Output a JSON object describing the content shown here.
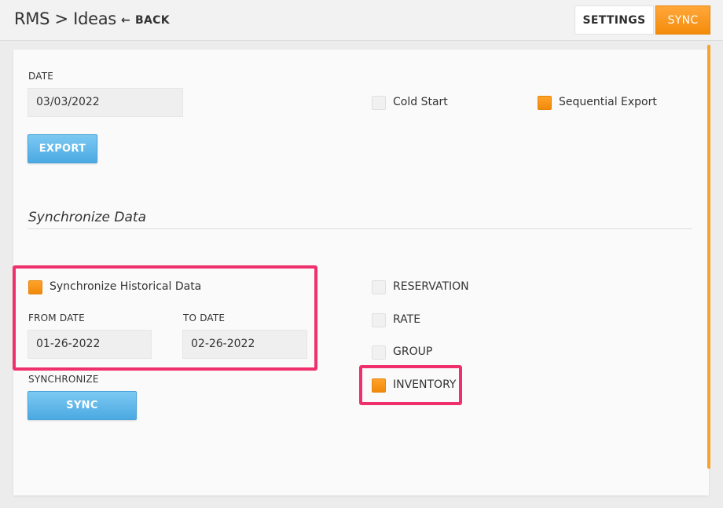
{
  "header": {
    "title": "RMS > Ideas",
    "back_label": "BACK",
    "settings_label": "SETTINGS",
    "sync_label": "SYNC"
  },
  "export": {
    "date_label": "DATE",
    "date_value": "03/03/2022",
    "export_label": "EXPORT",
    "cold_start": {
      "label": "Cold Start",
      "checked": false
    },
    "sequential_export": {
      "label": "Sequential Export",
      "checked": true
    }
  },
  "sync": {
    "section_title": "Synchronize Data",
    "historical": {
      "label": "Synchronize Historical Data",
      "checked": true
    },
    "from_label": "FROM DATE",
    "from_value": "01-26-2022",
    "to_label": "TO DATE",
    "to_value": "02-26-2022",
    "synchronize_label": "SYNCHRONIZE",
    "sync_button_label": "SYNC",
    "options": [
      {
        "label": "RESERVATION",
        "checked": false
      },
      {
        "label": "RATE",
        "checked": false
      },
      {
        "label": "GROUP",
        "checked": false
      },
      {
        "label": "INVENTORY",
        "checked": true
      }
    ]
  },
  "colors": {
    "accent_orange": "#f48c0c",
    "button_blue": "#4ba9e2",
    "highlight_pink": "#f0306c"
  },
  "icons": {
    "back": "left-arrow-icon"
  }
}
